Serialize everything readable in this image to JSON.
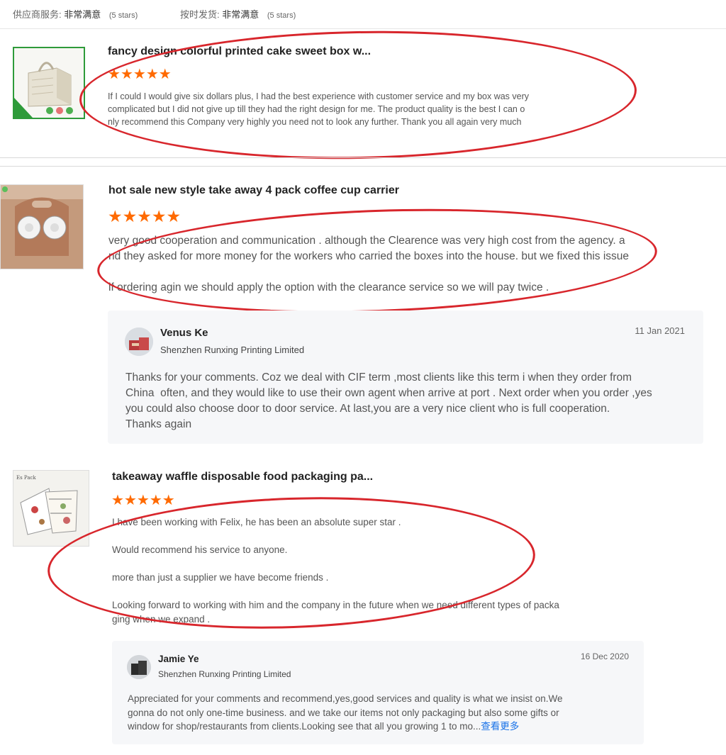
{
  "top": {
    "service_label": "供应商服务:",
    "service_value": "非常满意",
    "service_stars": "(5 stars)",
    "shipping_label": "按时发货:",
    "shipping_value": "非常满意",
    "shipping_stars": "(5 stars)"
  },
  "reviews": [
    {
      "title": "fancy design colorful printed cake sweet box w...",
      "rating": 5,
      "lines": [
        "If I could I would give six dollars plus, I had the best experience with customer service and my box was very",
        "complicated but I did not give up till they had the right design for me. The product quality is the best I can o",
        "nly recommend this Company very highly you need not to look any further. Thank you all again very much"
      ]
    },
    {
      "title": "hot sale new style take away 4 pack coffee cup carrier",
      "rating": 5,
      "lines": [
        "very good cooperation and communication . although the Clearence was very high cost from the agency. a",
        "nd they asked for more money for the workers who carried the boxes into the house. but we fixed this issue",
        "if ordering agin we should apply the option with the clearance service so we will pay twice ."
      ],
      "reply": {
        "name": "Venus Ke",
        "company": "Shenzhen Runxing Printing Limited",
        "date": "11 Jan 2021",
        "lines": [
          "Thanks for your comments. Coz we deal with CIF term ,most clients like this term i when they order from",
          "China  often, and they would like to use their own agent when arrive at port . Next order when you order ,yes",
          "you could also choose door to door service. At last,you are a very nice client who is full cooperation.",
          "Thanks again"
        ]
      }
    },
    {
      "title": "takeaway waffle disposable food packaging pa...",
      "rating": 5,
      "lines": [
        "I have been working with Felix, he has been an absolute super star .",
        "Would recommend his service to anyone.",
        "more than just a supplier we have become friends .",
        "Looking forward to working with him and the company in the future when we need different types of packa",
        "ging when we expand ."
      ],
      "reply": {
        "name": "Jamie Ye",
        "company": "Shenzhen Runxing Printing Limited",
        "date": "16 Dec 2020",
        "lines": [
          "Appreciated for your comments and recommend,yes,good services and quality is what we insist on.We",
          "gonna do not only one-time business. and we take our items not only packaging but also some gifts or",
          "window for shop/restaurants from clients.Looking see that all you growing 1 to mo..."
        ],
        "more_label": "查看更多"
      }
    }
  ],
  "colors": {
    "star": "#ff6a00",
    "annotation": "#d8262c",
    "link": "#1a73e8"
  },
  "icons": {
    "star": "star-icon"
  }
}
